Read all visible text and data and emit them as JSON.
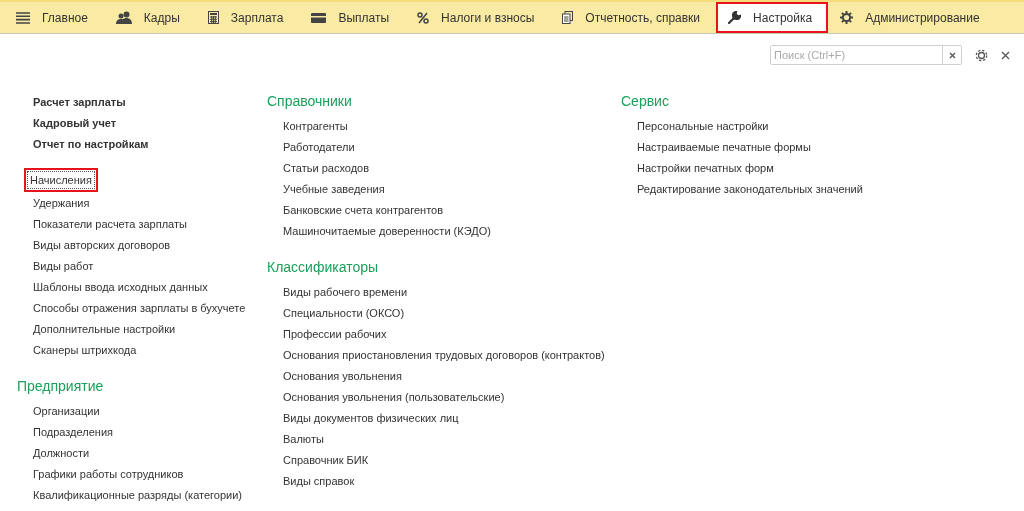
{
  "tabs": [
    {
      "label": "Главное",
      "selected": false,
      "highlighted": false
    },
    {
      "label": "Кадры",
      "selected": false,
      "highlighted": false
    },
    {
      "label": "Зарплата",
      "selected": false,
      "highlighted": false
    },
    {
      "label": "Выплаты",
      "selected": false,
      "highlighted": false
    },
    {
      "label": "Налоги и взносы",
      "selected": false,
      "highlighted": false
    },
    {
      "label": "Отчетность, справки",
      "selected": false,
      "highlighted": false
    },
    {
      "label": "Настройка",
      "selected": true,
      "highlighted": true
    },
    {
      "label": "Администрирование",
      "selected": false,
      "highlighted": false
    }
  ],
  "search": {
    "placeholder": "Поиск (Ctrl+F)"
  },
  "columns": [
    {
      "sections": [
        {
          "groups": [
            {
              "kind": "important",
              "items": [
                {
                  "label": "Расчет зарплаты",
                  "focused": false,
                  "highlighted": false
                },
                {
                  "label": "Кадровый учет",
                  "focused": false,
                  "highlighted": false
                },
                {
                  "label": "Отчет по настройкам",
                  "focused": false,
                  "highlighted": false
                }
              ]
            },
            {
              "kind": "regular",
              "items": [
                {
                  "label": "Начисления",
                  "focused": true,
                  "highlighted": true
                },
                {
                  "label": "Удержания",
                  "focused": false,
                  "highlighted": false
                },
                {
                  "label": "Показатели расчета зарплаты",
                  "focused": false,
                  "highlighted": false
                },
                {
                  "label": "Виды авторских договоров",
                  "focused": false,
                  "highlighted": false
                },
                {
                  "label": "Виды работ",
                  "focused": false,
                  "highlighted": false
                },
                {
                  "label": "Шаблоны ввода исходных данных",
                  "focused": false,
                  "highlighted": false
                },
                {
                  "label": "Способы отражения зарплаты в бухучете",
                  "focused": false,
                  "highlighted": false
                },
                {
                  "label": "Дополнительные настройки",
                  "focused": false,
                  "highlighted": false
                },
                {
                  "label": "Сканеры штрихкода",
                  "focused": false,
                  "highlighted": false
                }
              ]
            }
          ]
        },
        {
          "title": "Предприятие",
          "groups": [
            {
              "kind": "regular",
              "items": [
                {
                  "label": "Организации",
                  "focused": false,
                  "highlighted": false
                },
                {
                  "label": "Подразделения",
                  "focused": false,
                  "highlighted": false
                },
                {
                  "label": "Должности",
                  "focused": false,
                  "highlighted": false
                },
                {
                  "label": "Графики работы сотрудников",
                  "focused": false,
                  "highlighted": false
                },
                {
                  "label": "Квалификационные разряды (категории)",
                  "focused": false,
                  "highlighted": false
                }
              ]
            }
          ]
        }
      ]
    },
    {
      "sections": [
        {
          "title": "Справочники",
          "groups": [
            {
              "kind": "regular",
              "items": [
                {
                  "label": "Контрагенты",
                  "focused": false,
                  "highlighted": false
                },
                {
                  "label": "Работодатели",
                  "focused": false,
                  "highlighted": false
                },
                {
                  "label": "Статьи расходов",
                  "focused": false,
                  "highlighted": false
                },
                {
                  "label": "Учебные заведения",
                  "focused": false,
                  "highlighted": false
                },
                {
                  "label": "Банковские счета контрагентов",
                  "focused": false,
                  "highlighted": false
                },
                {
                  "label": "Машиночитаемые доверенности (КЭДО)",
                  "focused": false,
                  "highlighted": false
                }
              ]
            }
          ]
        },
        {
          "title": "Классификаторы",
          "groups": [
            {
              "kind": "regular",
              "items": [
                {
                  "label": "Виды рабочего времени",
                  "focused": false,
                  "highlighted": false
                },
                {
                  "label": "Специальности (ОКСО)",
                  "focused": false,
                  "highlighted": false
                },
                {
                  "label": "Профессии рабочих",
                  "focused": false,
                  "highlighted": false
                },
                {
                  "label": "Основания приостановления трудовых договоров (контрактов)",
                  "focused": false,
                  "highlighted": false
                },
                {
                  "label": "Основания увольнения",
                  "focused": false,
                  "highlighted": false
                },
                {
                  "label": "Основания увольнения (пользовательские)",
                  "focused": false,
                  "highlighted": false
                },
                {
                  "label": "Виды документов физических лиц",
                  "focused": false,
                  "highlighted": false
                },
                {
                  "label": "Валюты",
                  "focused": false,
                  "highlighted": false
                },
                {
                  "label": "Справочник БИК",
                  "focused": false,
                  "highlighted": false
                },
                {
                  "label": "Виды справок",
                  "focused": false,
                  "highlighted": false
                }
              ]
            }
          ]
        }
      ]
    },
    {
      "sections": [
        {
          "title": "Сервис",
          "groups": [
            {
              "kind": "regular",
              "items": [
                {
                  "label": "Персональные настройки",
                  "focused": false,
                  "highlighted": false
                },
                {
                  "label": "Настраиваемые печатные формы",
                  "focused": false,
                  "highlighted": false
                },
                {
                  "label": "Настройки печатных форм",
                  "focused": false,
                  "highlighted": false
                },
                {
                  "label": "Редактирование законодательных значений",
                  "focused": false,
                  "highlighted": false
                }
              ]
            }
          ]
        }
      ]
    }
  ]
}
